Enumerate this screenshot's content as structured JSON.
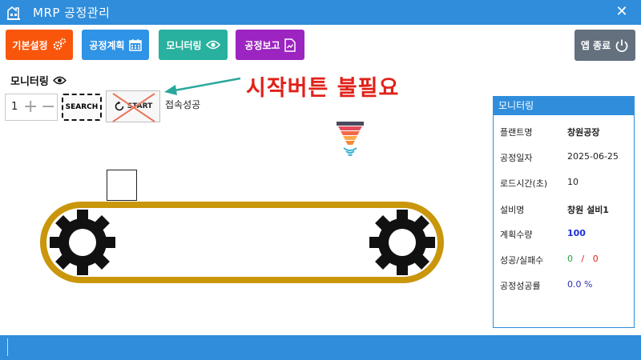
{
  "window": {
    "title": "MRP 공정관리",
    "close_label": "✕"
  },
  "toolbar": {
    "basic_label": "기본설정",
    "plan_label": "공정계획",
    "monitor_label": "모니터링",
    "report_label": "공정보고",
    "exit_label": "앱 종료"
  },
  "section": {
    "title": "모니터링"
  },
  "controls": {
    "stepper_value": "1",
    "plus": "+",
    "minus": "−",
    "search_label": "SEARCH",
    "start_label": "START",
    "status_text": "접속성공"
  },
  "annotation": {
    "text": "시작버튼 불필요"
  },
  "panel": {
    "title": "모니터링",
    "rows": [
      {
        "label": "플랜트명",
        "value": "창원공장"
      },
      {
        "label": "공정일자",
        "value": "2025-06-25"
      },
      {
        "label": "로드시간(초)",
        "value": "10"
      },
      {
        "label": "설비명",
        "value": "창원 설비1"
      },
      {
        "label": "계획수량",
        "value": "100"
      },
      {
        "label": "성공/실패수",
        "success": "0",
        "sep": "/",
        "fail": "0"
      },
      {
        "label": "공정성공률",
        "value": "0.0 %"
      }
    ]
  },
  "colors": {
    "titlebar": "#2f8ddc",
    "basic": "#f9560b",
    "plan": "#2f93e6",
    "monitor": "#27b19e",
    "report": "#9c24c1",
    "exit": "#64707e",
    "belt": "#c9960c",
    "annotation": "#e0221a",
    "arrow": "#2aa79c"
  }
}
